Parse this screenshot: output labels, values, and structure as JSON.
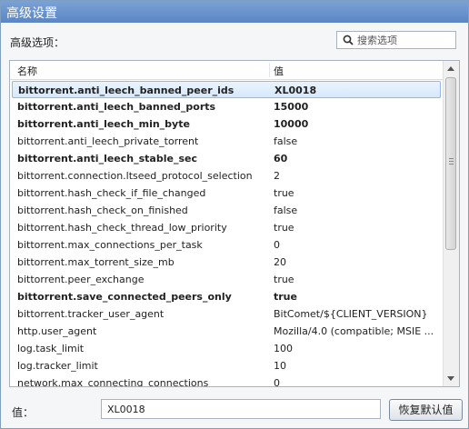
{
  "window": {
    "title": "高级设置"
  },
  "advanced": {
    "label": "高级选项："
  },
  "search": {
    "placeholder": "搜索选项"
  },
  "list": {
    "headers": {
      "name": "名称",
      "value": "值"
    },
    "rows": [
      {
        "name": "bittorrent.anti_leech_banned_peer_ids",
        "value": "XL0018",
        "bold": true,
        "selected": true
      },
      {
        "name": "bittorrent.anti_leech_banned_ports",
        "value": "15000",
        "bold": true
      },
      {
        "name": "bittorrent.anti_leech_min_byte",
        "value": "10000",
        "bold": true
      },
      {
        "name": "bittorrent.anti_leech_private_torrent",
        "value": "false",
        "bold": false
      },
      {
        "name": "bittorrent.anti_leech_stable_sec",
        "value": "60",
        "bold": true
      },
      {
        "name": "bittorrent.connection.ltseed_protocol_selection",
        "value": "2",
        "bold": false
      },
      {
        "name": "bittorrent.hash_check_if_file_changed",
        "value": "true",
        "bold": false
      },
      {
        "name": "bittorrent.hash_check_on_finished",
        "value": "false",
        "bold": false
      },
      {
        "name": "bittorrent.hash_check_thread_low_priority",
        "value": "true",
        "bold": false
      },
      {
        "name": "bittorrent.max_connections_per_task",
        "value": "0",
        "bold": false
      },
      {
        "name": "bittorrent.max_torrent_size_mb",
        "value": "20",
        "bold": false
      },
      {
        "name": "bittorrent.peer_exchange",
        "value": "true",
        "bold": false
      },
      {
        "name": "bittorrent.save_connected_peers_only",
        "value": "true",
        "bold": true
      },
      {
        "name": "bittorrent.tracker_user_agent",
        "value": "BitComet/${CLIENT_VERSION}",
        "bold": false
      },
      {
        "name": "http.user_agent",
        "value": "Mozilla/4.0 (compatible; MSIE ...",
        "bold": false
      },
      {
        "name": "log.task_limit",
        "value": "100",
        "bold": false
      },
      {
        "name": "log.tracker_limit",
        "value": "10",
        "bold": false
      },
      {
        "name": "network.max_connecting_connections",
        "value": "0",
        "bold": false
      }
    ]
  },
  "footer": {
    "value_label": "值：",
    "value": "XL0018",
    "restore_label": "恢复默认值"
  },
  "colors": {
    "titlebar": "#6b93cc",
    "selection": "#dbeafc"
  }
}
